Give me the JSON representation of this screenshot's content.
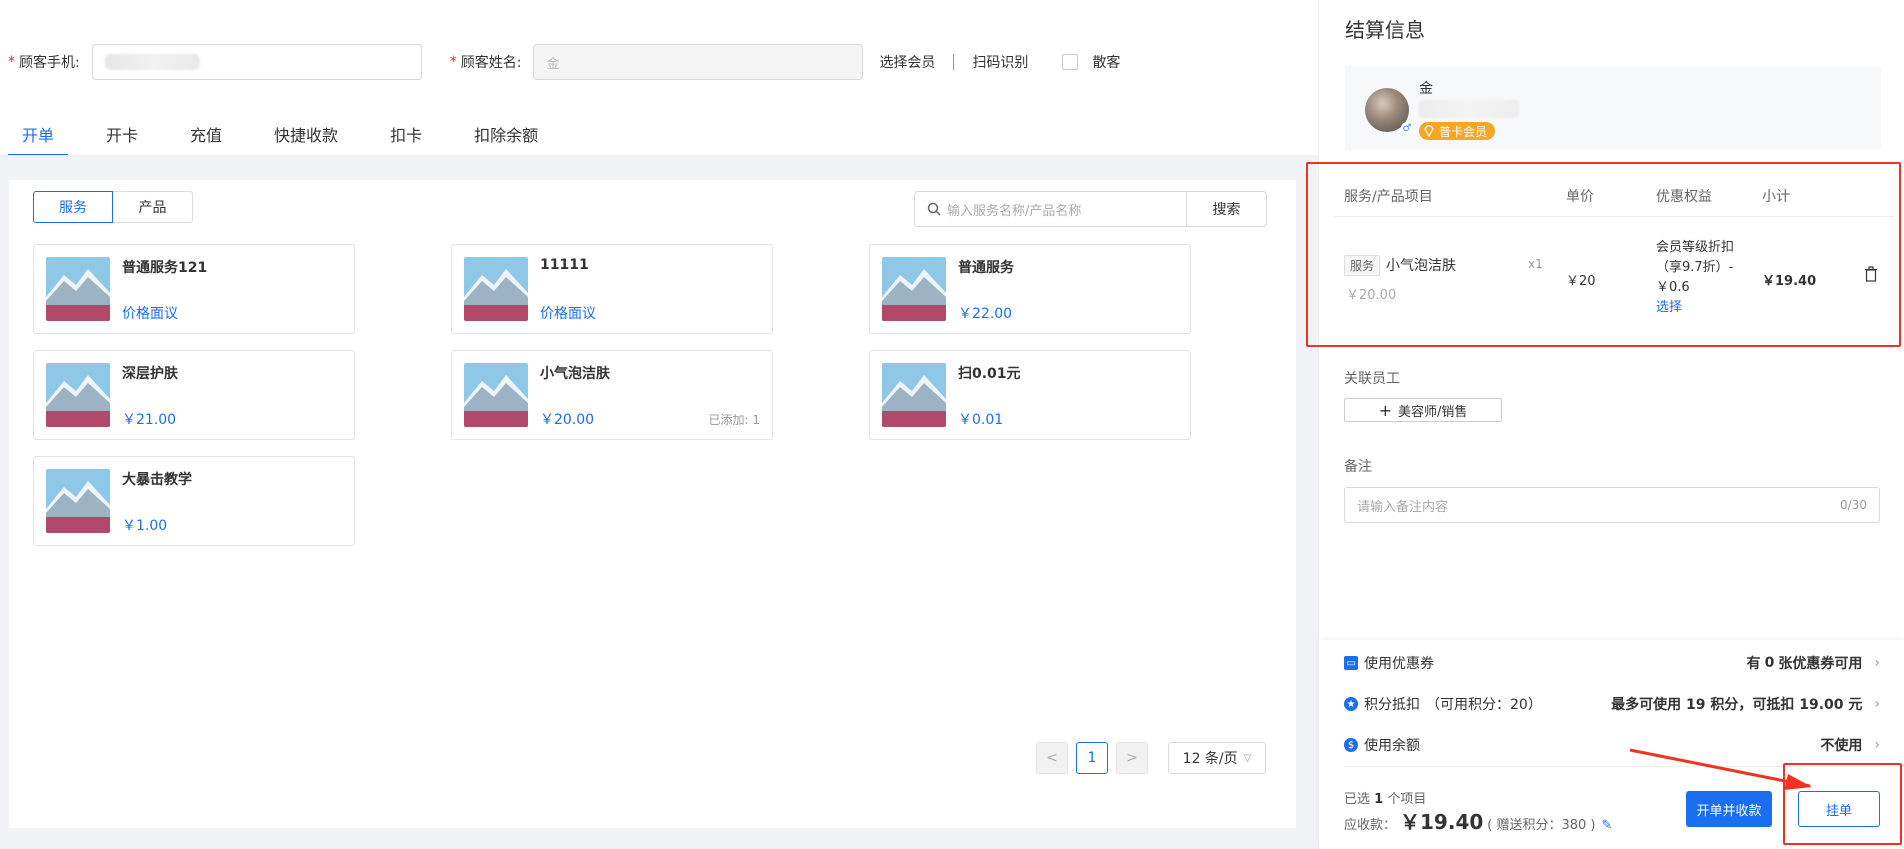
{
  "customer": {
    "phone_label": "顾客手机:",
    "name_label": "顾客姓名:",
    "name_value": "金",
    "select_member": "选择会员",
    "scan": "扫码识别",
    "walk_in": "散客"
  },
  "tabs": [
    {
      "label": "开单",
      "active": true
    },
    {
      "label": "开卡"
    },
    {
      "label": "充值"
    },
    {
      "label": "快捷收款"
    },
    {
      "label": "扣卡"
    },
    {
      "label": "扣除余额"
    }
  ],
  "segment": {
    "services": "服务",
    "products": "产品"
  },
  "search": {
    "placeholder": "输入服务名称/产品名称",
    "button": "搜索"
  },
  "items": [
    {
      "name": "普通服务121",
      "price": "价格面议"
    },
    {
      "name": "11111",
      "price": "价格面议"
    },
    {
      "name": "普通服务",
      "price": "￥22.00"
    },
    {
      "name": "深层护肤",
      "price": "￥21.00"
    },
    {
      "name": "小气泡洁肤",
      "price": "￥20.00",
      "added": "已添加: 1"
    },
    {
      "name": "扫0.01元",
      "price": "￥0.01"
    },
    {
      "name": "大暴击教学",
      "price": "￥1.00"
    }
  ],
  "pagination": {
    "current": "1",
    "prev": "<",
    "next": ">",
    "page_size": "12 条/页"
  },
  "settlement": {
    "title": "结算信息",
    "member_name": "金",
    "member_badge": "普卡会员",
    "gender": "♂",
    "table_headers": {
      "item": "服务/产品项目",
      "unit_price": "单价",
      "discount": "优惠权益",
      "subtotal": "小计"
    },
    "line": {
      "tag": "服务",
      "name": "小气泡洁肤",
      "qty": "x1",
      "orig_price": "￥20.00",
      "unit_price": "￥20",
      "discount_line1": "会员等级折扣",
      "discount_line2": "（享9.7折）-",
      "discount_line3": "￥0.6",
      "discount_select": "选择",
      "subtotal": "￥19.40"
    },
    "staff_label": "关联员工",
    "staff_button": "美容师/销售",
    "remark_label": "备注",
    "remark_placeholder": "请输入备注内容",
    "remark_count": "0/30",
    "coupon_label": "使用优惠券",
    "coupon_value_pre": "有",
    "coupon_value_num": "0",
    "coupon_value_post": "张优惠券可用",
    "points_label": "积分抵扣",
    "points_available": "（可用积分：20）",
    "points_value": "最多可使用 19 积分，可抵扣 19.00 元",
    "balance_label": "使用余额",
    "balance_value": "不使用",
    "selected_pre": "已选",
    "selected_num": "1",
    "selected_post": "个项目",
    "due_label": "应收款：",
    "due_amount": "￥19.40",
    "bonus_points": "( 赠送积分：380 )",
    "btn_checkout": "开单并收款",
    "btn_hold": "挂单"
  },
  "colors": {
    "accent": "#1a6ef0",
    "highlight": "#ee3322",
    "badge": "#f5a623"
  }
}
